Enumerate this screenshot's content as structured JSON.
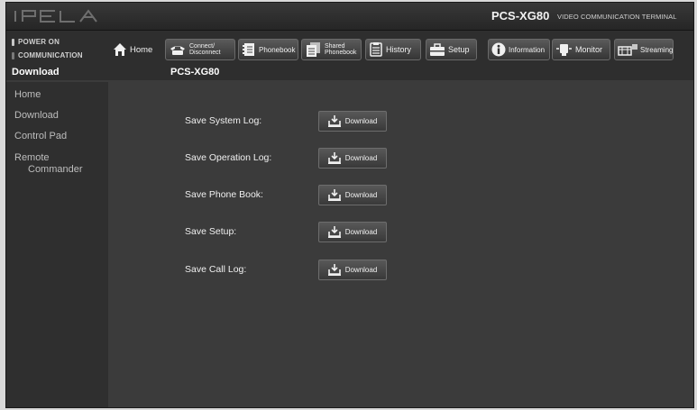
{
  "header": {
    "logo_text": "IPELA",
    "model": "PCS-XG80",
    "subtitle": "VIDEO COMMUNICATION TERMINAL"
  },
  "status": {
    "power": "POWER ON",
    "communication": "COMMUNICATION",
    "power_color": "#c8c8c8",
    "communication_color": "#7a7a7a"
  },
  "nav": [
    {
      "label": "Home",
      "icon": "home-icon"
    },
    {
      "label_line1": "Connect/",
      "label_line2": "Disconnect",
      "icon": "phone-icon"
    },
    {
      "label": "Phonebook",
      "icon": "phonebook-icon"
    },
    {
      "label_line1": "Shared",
      "label_line2": "Phonebook",
      "icon": "shared-phonebook-icon"
    },
    {
      "label": "History",
      "icon": "history-icon"
    },
    {
      "label": "Setup",
      "icon": "toolbox-icon"
    },
    {
      "label": "Information",
      "icon": "info-icon"
    },
    {
      "label": "Monitor",
      "icon": "monitor-icon"
    },
    {
      "label": "Streaming",
      "icon": "streaming-icon"
    }
  ],
  "page": {
    "section": "Download",
    "model": "PCS-XG80"
  },
  "sidebar": {
    "items": [
      {
        "label": "Home"
      },
      {
        "label": "Download"
      },
      {
        "label": "Control Pad"
      },
      {
        "label_line1": "Remote",
        "label_line2": "Commander"
      }
    ]
  },
  "downloads": [
    {
      "label": "Save System Log:",
      "button": "Download"
    },
    {
      "label": "Save Operation Log:",
      "button": "Download"
    },
    {
      "label": "Save Phone Book:",
      "button": "Download"
    },
    {
      "label": "Save Setup:",
      "button": "Download"
    },
    {
      "label": "Save Call Log:",
      "button": "Download"
    }
  ]
}
